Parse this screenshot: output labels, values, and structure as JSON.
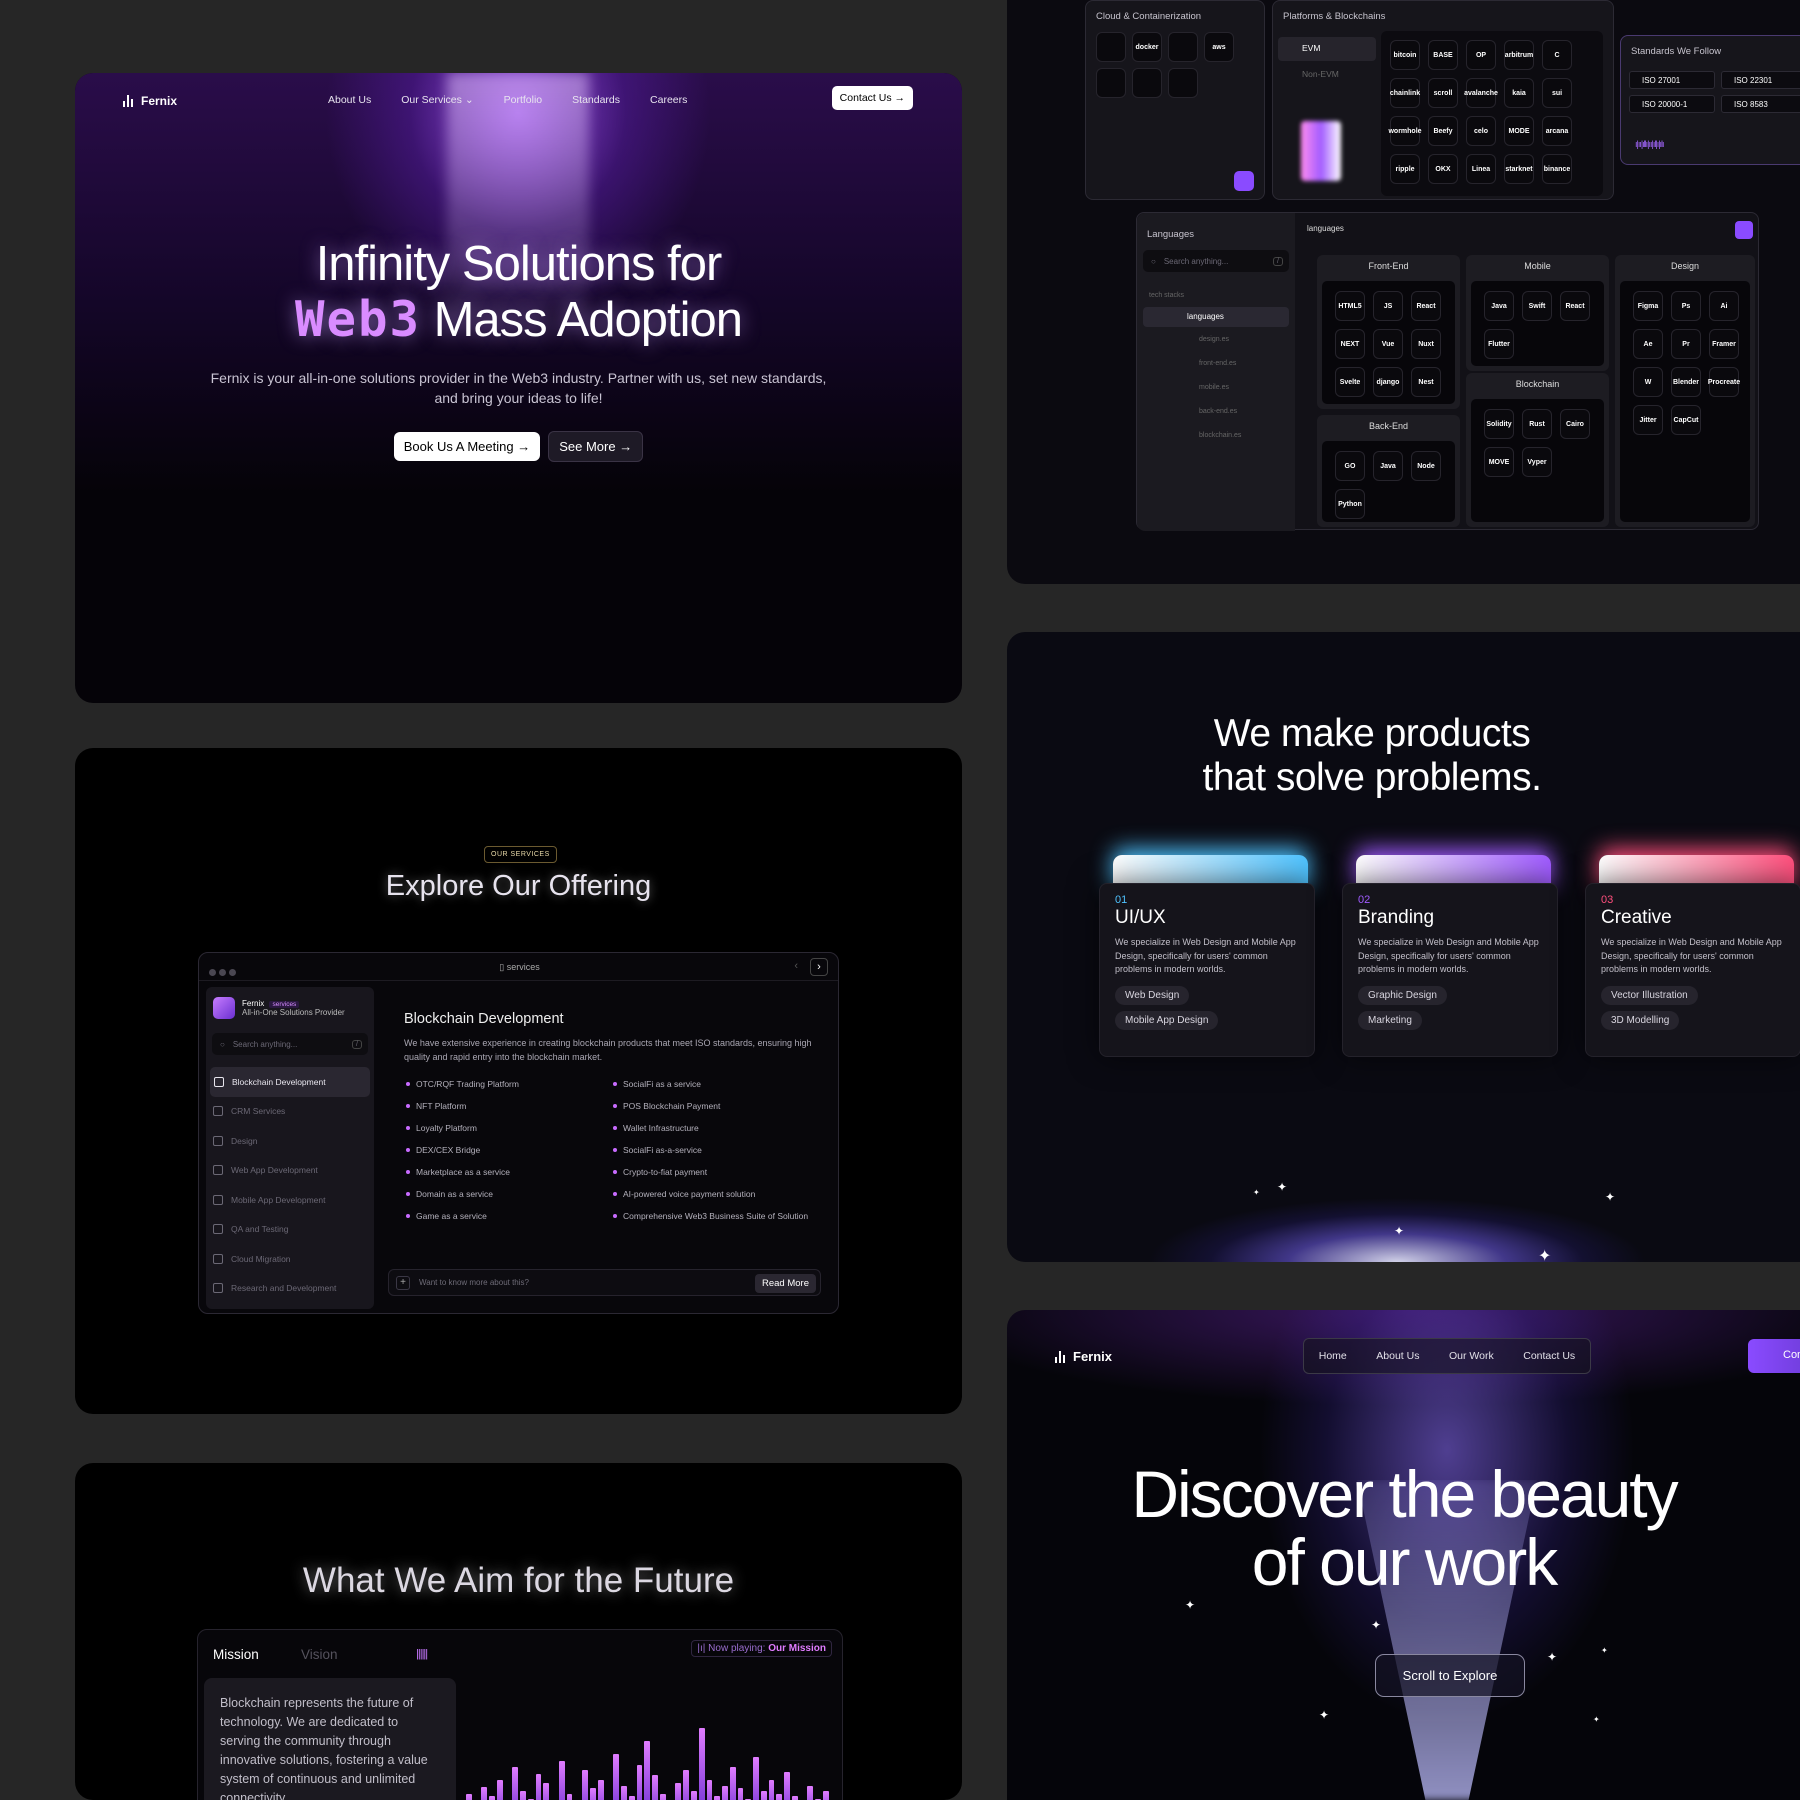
{
  "hero": {
    "brand": "Fernix",
    "nav": [
      "About Us",
      "Our Services",
      "Portfolio",
      "Standards",
      "Careers"
    ],
    "contact": "Contact Us",
    "title_line1": "Infinity Solutions for",
    "title_web3": "Web3",
    "title_line2": "Mass Adoption",
    "lead": "Fernix is your all-in-one solutions provider in the Web3 industry. Partner with us, set new standards, and bring your ideas to life!",
    "cta_primary": "Book Us A Meeting",
    "cta_secondary": "See More"
  },
  "services": {
    "tag": "OUR SERVICES",
    "title": "Explore Our Offering",
    "window_title": "services",
    "brand": "Fernix",
    "brand_badge": "services",
    "brand_sub": "All-in-One Solutions Provider",
    "search_placeholder": "Search anything...",
    "search_key": "/",
    "menu": [
      "Blockchain Development",
      "CRM Services",
      "Design",
      "Web App Development",
      "Mobile App Development",
      "QA and Testing",
      "Cloud Migration",
      "Research and Development"
    ],
    "heading": "Blockchain Development",
    "description": "We have extensive experience in creating blockchain products that meet ISO standards, ensuring high quality and rapid entry into the blockchain market.",
    "col1": [
      "OTC/RQF Trading Platform",
      "NFT Platform",
      "Loyalty Platform",
      "DEX/CEX Bridge",
      "Marketplace as a service",
      "Domain as a service",
      "Game as a service"
    ],
    "col2": [
      "SocialFi as a service",
      "POS Blockchain Payment",
      "Wallet Infrastructure",
      "SocialFi as-a-service",
      "Crypto-to-fiat payment",
      "AI-powered voice payment solution",
      "Comprehensive Web3 Business Suite of Solution"
    ],
    "ask_placeholder": "Want to know more about this?",
    "read_more": "Read More"
  },
  "future": {
    "title": "What We Aim for the Future",
    "tab_mission": "Mission",
    "tab_vision": "Vision",
    "now_playing_label": "Now playing:",
    "now_playing_value": "Our Mission",
    "mission_text": "Blockchain represents the future of technology. We are dedicated to serving the community through innovative solutions, fostering a value system of continuous and unlimited connectivity."
  },
  "tech": {
    "cloud_title": "Cloud & Containerization",
    "cloud_icons": [
      "kubernetes",
      "docker",
      "google-cloud",
      "aws",
      "digitalocean",
      "azure",
      "cloud-misc"
    ],
    "cloud_labels": [
      "",
      "docker",
      "",
      "aws",
      "",
      "",
      ""
    ],
    "platforms_title": "Platforms & Blockchains",
    "evm": "EVM",
    "non_evm": "Non-EVM",
    "chains": [
      "bitcoin",
      "BASE",
      "OP",
      "arbitrum",
      "C",
      "chainlink",
      "scroll",
      "avalanche",
      "kaia",
      "sui",
      "wormhole",
      "Beefy",
      "celo",
      "MODE",
      "arcana",
      "ripple",
      "OKX",
      "Linea",
      "starknet",
      "binance"
    ],
    "standards_title": "Standards We Follow",
    "standards": [
      "ISO 27001",
      "ISO 22301",
      "ISO 20000-1",
      "ISO 8583"
    ],
    "languages_title": "Languages",
    "languages_tab": "languages",
    "search_placeholder": "Search anything...",
    "tree_root": "tech stacks",
    "tree_folder": "languages",
    "tree_files": [
      "design.es",
      "front-end.es",
      "mobile.es",
      "back-end.es",
      "blockchain.es"
    ],
    "frontend_title": "Front-End",
    "frontend": [
      "HTML5",
      "JS",
      "React",
      "NEXT",
      "Vue",
      "Nuxt",
      "Svelte",
      "django",
      "Nest"
    ],
    "mobile_title": "Mobile",
    "mobile": [
      "Java",
      "Swift",
      "React",
      "Flutter"
    ],
    "blockchain_title": "Blockchain",
    "blockchain": [
      "Solidity",
      "Rust",
      "Cairo",
      "MOVE",
      "Vyper"
    ],
    "backend_title": "Back-End",
    "backend": [
      "GO",
      "Java",
      "Node",
      "Python"
    ],
    "design_title": "Design",
    "design": [
      "Figma",
      "Ps",
      "Ai",
      "Ae",
      "Pr",
      "Framer",
      "W",
      "Blender",
      "Procreate",
      "Jitter",
      "CapCut"
    ]
  },
  "products": {
    "title_line1": "We make products",
    "title_line2": "that solve problems.",
    "folders": [
      {
        "num": "01",
        "name": "UI/UX",
        "desc": "We specialize in Web Design and Mobile App Design, specifically for users' common problems in modern worlds.",
        "chips": [
          "Web Design",
          "Mobile App Design"
        ],
        "color": "#4fc3ff"
      },
      {
        "num": "02",
        "name": "Branding",
        "desc": "We specialize in Web Design and Mobile App Design, specifically for users' common problems in modern worlds.",
        "chips": [
          "Graphic Design",
          "Marketing"
        ],
        "color": "#a05bff"
      },
      {
        "num": "03",
        "name": "Creative",
        "desc": "We specialize in Web Design and Mobile App Design, specifically for users' common problems in modern worlds.",
        "chips": [
          "Vector Illustration",
          "3D Modelling"
        ],
        "color": "#ff4f7d"
      }
    ]
  },
  "work": {
    "brand": "Fernix",
    "nav": [
      "Home",
      "About Us",
      "Our Work",
      "Contact Us"
    ],
    "contact": "Conta",
    "title_line1": "Discover the beauty",
    "title_line2": "of our work",
    "scroll": "Scroll to Explore"
  }
}
